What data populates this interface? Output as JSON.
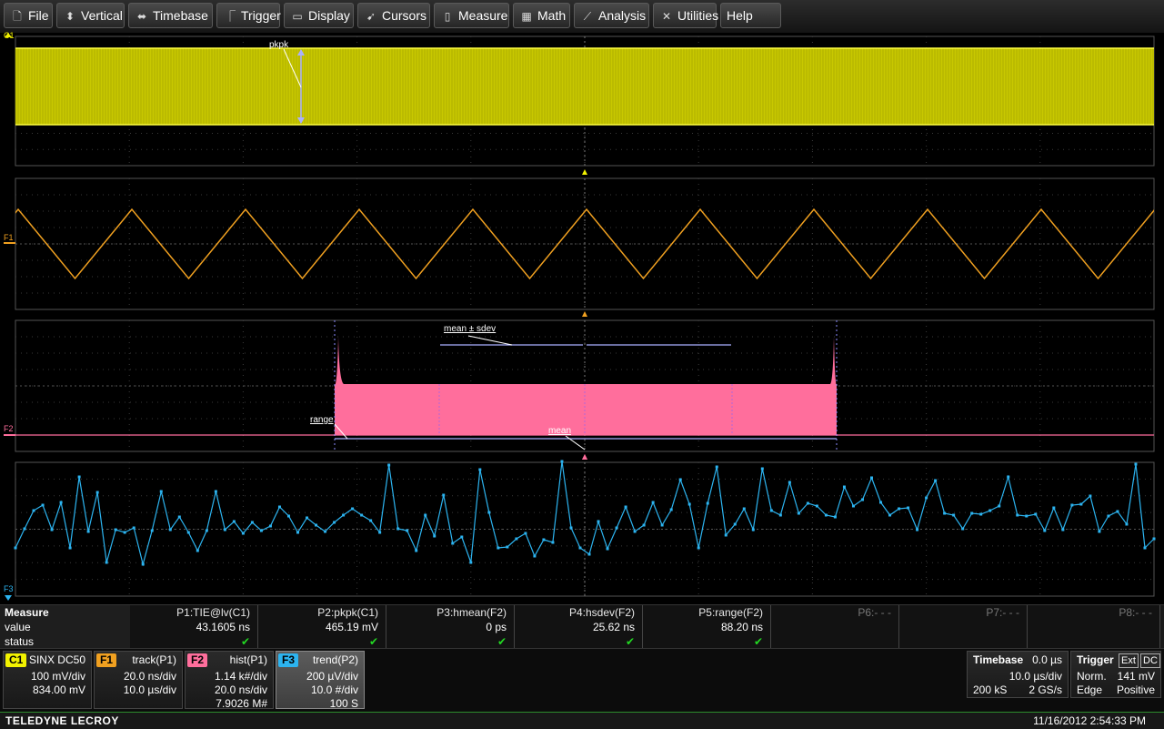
{
  "menu": {
    "items": [
      {
        "label": "File",
        "icon": "file-icon",
        "glyph": "🗋"
      },
      {
        "label": "Vertical",
        "icon": "vertical-icon",
        "glyph": "⬍"
      },
      {
        "label": "Timebase",
        "icon": "timebase-icon",
        "glyph": "⬌"
      },
      {
        "label": "Trigger",
        "icon": "trigger-icon",
        "glyph": "⎾"
      },
      {
        "label": "Display",
        "icon": "display-icon",
        "glyph": "▭"
      },
      {
        "label": "Cursors",
        "icon": "cursors-icon",
        "glyph": "➹"
      },
      {
        "label": "Measure",
        "icon": "measure-icon",
        "glyph": "▯"
      },
      {
        "label": "Math",
        "icon": "math-icon",
        "glyph": "▦"
      },
      {
        "label": "Analysis",
        "icon": "analysis-icon",
        "glyph": "⟋"
      },
      {
        "label": "Utilities",
        "icon": "utilities-icon",
        "glyph": "✕"
      },
      {
        "label": "Help",
        "icon": "",
        "glyph": ""
      }
    ]
  },
  "traces": {
    "c1_label": "C1",
    "f1_label": "F1",
    "f2_label": "F2",
    "f3_label": "F3",
    "pkpk_annotation": "pkpk",
    "mean_sdev_annotation": "mean ± sdev",
    "range_annotation": "range",
    "mean_annotation": "mean",
    "colors": {
      "c1": "#f2f200",
      "f1": "#f0a020",
      "f2": "#ff6e9c",
      "f3": "#2cb4f0"
    }
  },
  "measure": {
    "row_labels": {
      "title": "Measure",
      "value": "value",
      "status": "status"
    },
    "params": [
      {
        "name": "P1:TIE@lv(C1)",
        "value": "43.1605 ns",
        "ok": "✔"
      },
      {
        "name": "P2:pkpk(C1)",
        "value": "465.19 mV",
        "ok": "✔"
      },
      {
        "name": "P3:hmean(F2)",
        "value": "0 ps",
        "ok": "✔"
      },
      {
        "name": "P4:hsdev(F2)",
        "value": "25.62 ns",
        "ok": "✔"
      },
      {
        "name": "P5:range(F2)",
        "value": "88.20 ns",
        "ok": "✔"
      },
      {
        "name": "P6:- - -",
        "value": "",
        "ok": ""
      },
      {
        "name": "P7:- - -",
        "value": "",
        "ok": ""
      },
      {
        "name": "P8:- - -",
        "value": "",
        "ok": ""
      }
    ]
  },
  "descriptors": {
    "c1": {
      "tag": "C1",
      "header": "SINX  DC50",
      "line1": "100 mV/div",
      "line2": "834.00 mV"
    },
    "f1": {
      "tag": "F1",
      "header": "track(P1)",
      "line1": "20.0 ns/div",
      "line2": "10.0 µs/div"
    },
    "f2": {
      "tag": "F2",
      "header": "hist(P1)",
      "line1": "1.14 k#/div",
      "line2": "20.0 ns/div",
      "line3": "7.9026 M#"
    },
    "f3": {
      "tag": "F3",
      "header": "trend(P2)",
      "line1": "200 µV/div",
      "line2": "10.0 #/div",
      "line3": "100 S"
    },
    "timebase": {
      "title": "Timebase",
      "delay": "0.0 µs",
      "div": "10.0 µs/div",
      "samples": "200 kS",
      "rate": "2 GS/s"
    },
    "trigger": {
      "title": "Trigger",
      "ext": "Ext",
      "dc": "DC",
      "mode": "Norm.",
      "level": "141 mV",
      "type": "Edge",
      "slope": "Positive"
    }
  },
  "status": {
    "brand": "TELEDYNE LECROY",
    "datetime": "11/16/2012 2:54:33 PM"
  }
}
